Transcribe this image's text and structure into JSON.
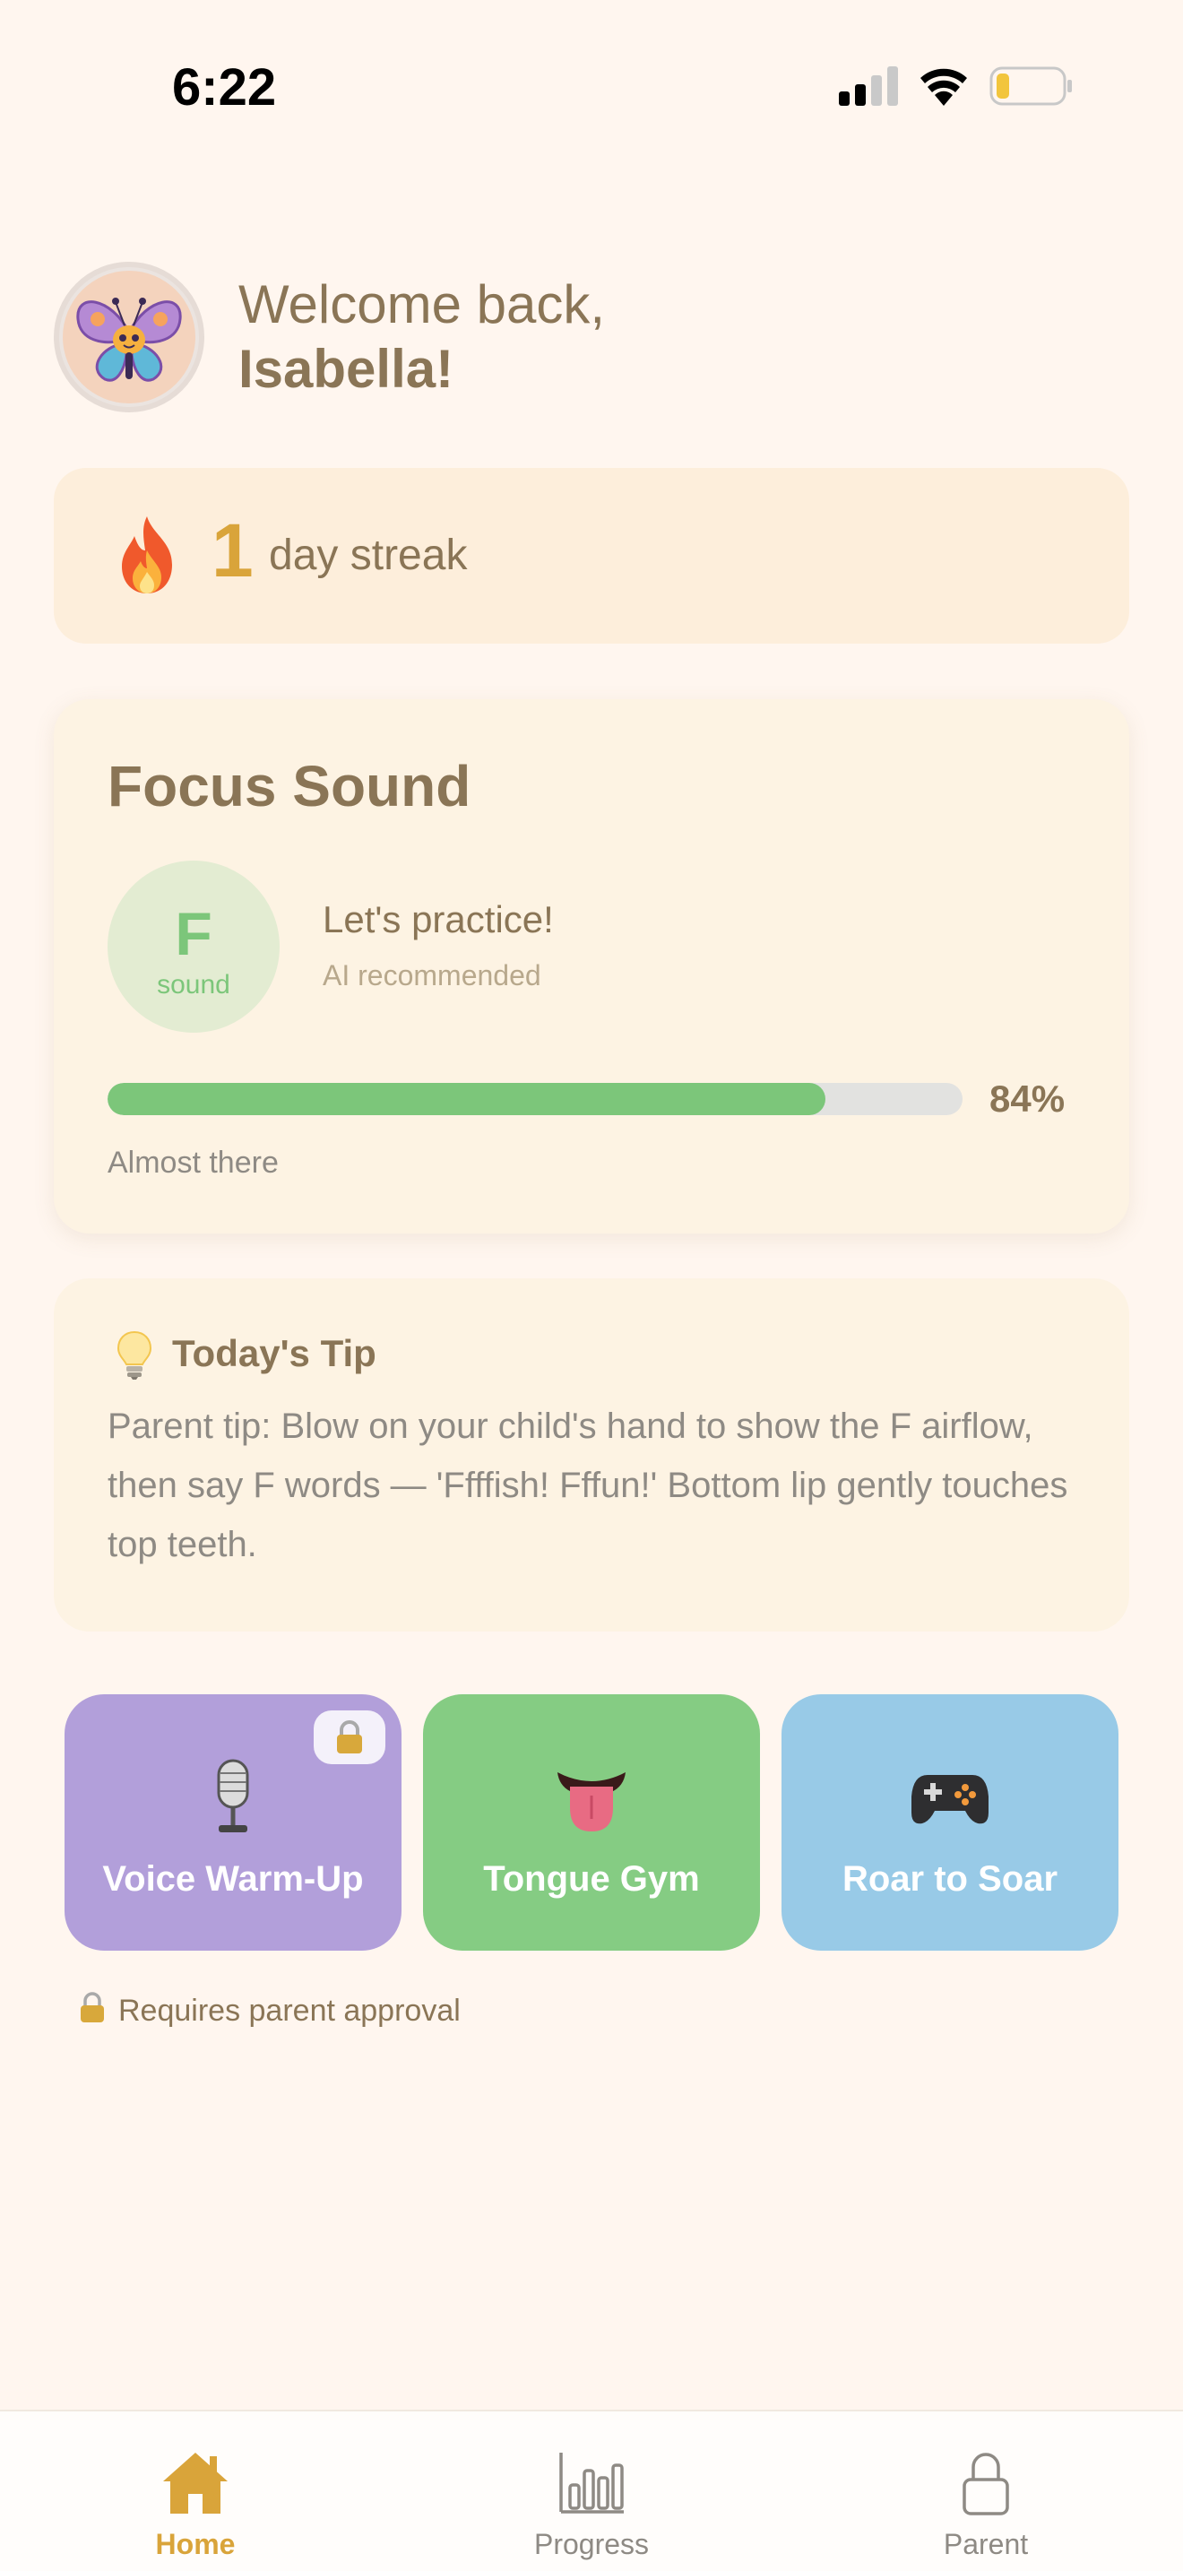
{
  "status_bar": {
    "time": "6:22"
  },
  "header": {
    "greeting": "Welcome back,",
    "user_name": "Isabella!",
    "avatar_icon": "butterfly-mascot-icon"
  },
  "streak": {
    "icon": "flame-icon",
    "count": "1",
    "label": "day streak"
  },
  "focus": {
    "title": "Focus Sound",
    "sound_letter": "F",
    "sound_caption": "sound",
    "prompt": "Let's practice!",
    "source": "AI recommended",
    "progress_value": 84,
    "progress_text": "84%",
    "progress_caption": "Almost there"
  },
  "tip": {
    "icon": "lightbulb-icon",
    "title": "Today's Tip",
    "body": "Parent tip: Blow on your child's hand to show the F airflow, then say F words — 'Ffffish! Fffun!' Bottom lip gently touches top teeth."
  },
  "activities": [
    {
      "label": "Voice Warm-Up",
      "icon": "microphone-icon",
      "locked": true,
      "color": "#b29fda"
    },
    {
      "label": "Tongue Gym",
      "icon": "tongue-icon",
      "locked": false,
      "color": "#85cc83"
    },
    {
      "label": "Roar to Soar",
      "icon": "game-controller-icon",
      "locked": false,
      "color": "#98cae7"
    }
  ],
  "approval_note": "Requires parent approval",
  "tabs": [
    {
      "label": "Home",
      "icon": "home-icon",
      "active": true
    },
    {
      "label": "Progress",
      "icon": "bar-chart-icon",
      "active": false
    },
    {
      "label": "Parent",
      "icon": "lock-icon",
      "active": false
    }
  ],
  "colors": {
    "accent": "#d9a43a",
    "text_brown": "#8a7556",
    "progress_green": "#7cc67a",
    "background": "#fff6ef"
  }
}
